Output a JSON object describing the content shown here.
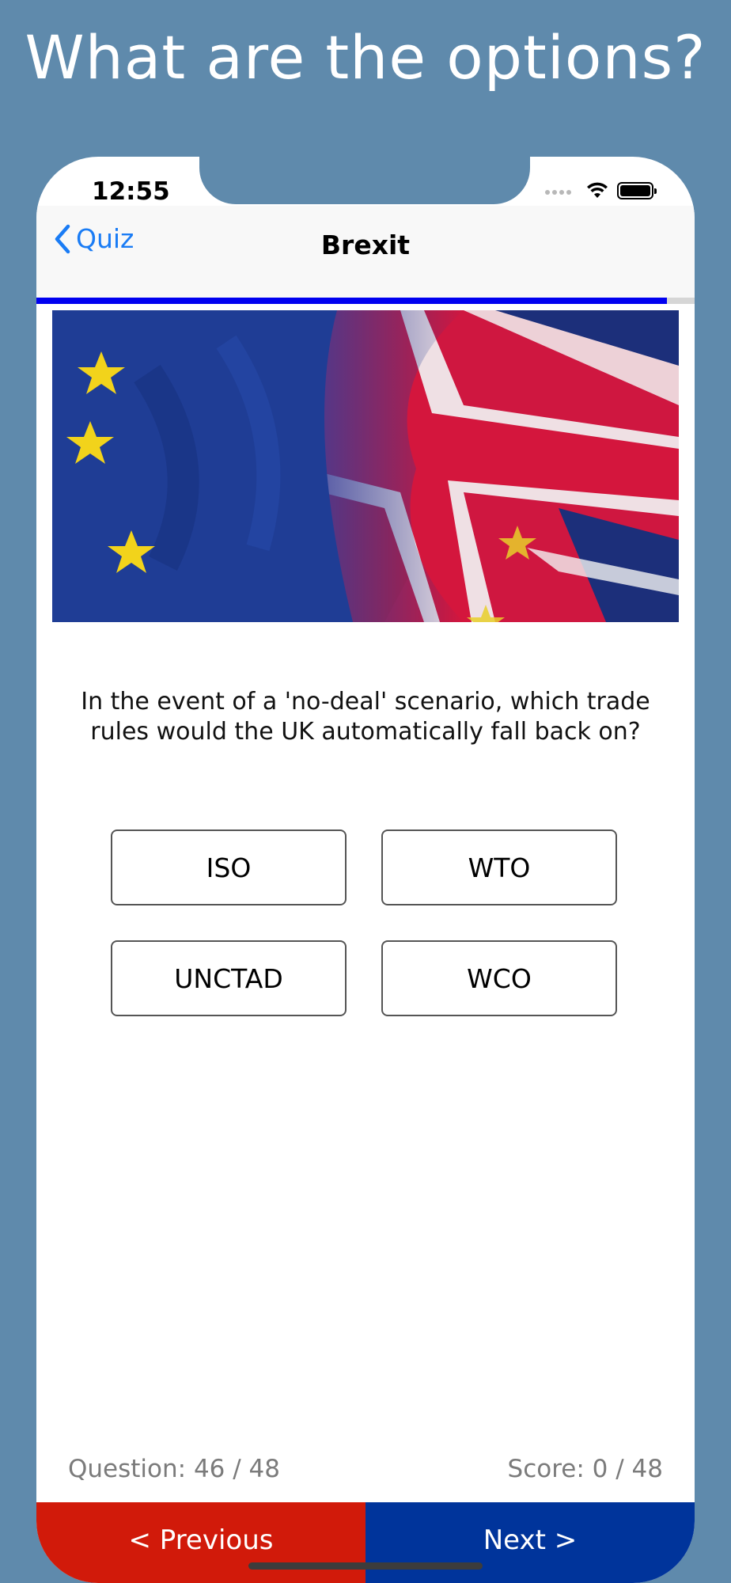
{
  "promo": {
    "title": "What are the options?"
  },
  "status_bar": {
    "time": "12:55"
  },
  "nav": {
    "back_label": "Quiz",
    "title": "Brexit"
  },
  "progress": {
    "fraction": 0.958
  },
  "question": {
    "text": "In the event of a 'no-deal' scenario, which trade rules would the UK automatically fall back on?"
  },
  "answers": [
    {
      "label": "ISO"
    },
    {
      "label": "WTO"
    },
    {
      "label": "UNCTAD"
    },
    {
      "label": "WCO"
    }
  ],
  "footer": {
    "question_counter": "Question: 46 / 48",
    "score": "Score: 0 / 48"
  },
  "bottom_bar": {
    "previous_label": "< Previous",
    "next_label": "Next >"
  },
  "colors": {
    "background": "#5f8aac",
    "accent": "#1a7cf5",
    "progress": "#0000f0",
    "previous": "#d11a0a",
    "next": "#00349b"
  },
  "icons": {
    "back": "chevron-left-icon",
    "wifi": "wifi-icon",
    "battery": "battery-icon",
    "signal": "cellular-signal-icon"
  }
}
